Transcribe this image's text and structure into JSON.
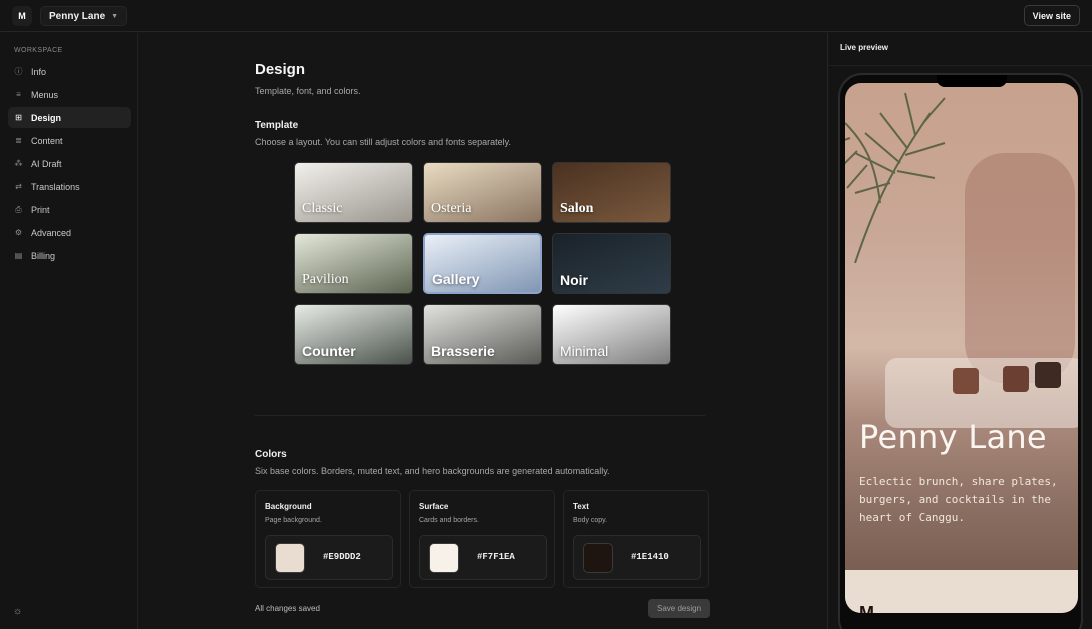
{
  "topbar": {
    "workspace_initial": "M",
    "workspace_name": "Penny Lane",
    "view_site_label": "View site"
  },
  "sidebar": {
    "section_label": "WORKSPACE",
    "items": [
      {
        "label": "Info",
        "icon": "info-icon",
        "glyph": "ⓘ"
      },
      {
        "label": "Menus",
        "icon": "menu-lines-icon",
        "glyph": "≡"
      },
      {
        "label": "Design",
        "icon": "grid-icon",
        "glyph": "⊞"
      },
      {
        "label": "Content",
        "icon": "text-lines-icon",
        "glyph": "≣"
      },
      {
        "label": "AI Draft",
        "icon": "sparkle-icon",
        "glyph": "⁂"
      },
      {
        "label": "Translations",
        "icon": "swap-icon",
        "glyph": "⇄"
      },
      {
        "label": "Print",
        "icon": "printer-icon",
        "glyph": "⎙"
      },
      {
        "label": "Advanced",
        "icon": "gear-icon",
        "glyph": "⚙"
      },
      {
        "label": "Billing",
        "icon": "card-icon",
        "glyph": "▤"
      }
    ],
    "active": "Design"
  },
  "main": {
    "title": "Design",
    "subtitle": "Template, font, and colors.",
    "template": {
      "title": "Template",
      "subtitle": "Choose a layout. You can still adjust colors and fonts separately.",
      "selected": "Gallery",
      "items": [
        {
          "label": "Classic",
          "font": "serif",
          "from": "#f2f0ec",
          "to": "#9a968e"
        },
        {
          "label": "Osteria",
          "font": "serif",
          "from": "#e9dcc3",
          "to": "#8a7460"
        },
        {
          "label": "Salon",
          "font": "serif-bold",
          "from": "#4a3120",
          "to": "#7a5a3e"
        },
        {
          "label": "Pavilion",
          "font": "serif",
          "from": "#e4e8da",
          "to": "#5c6450"
        },
        {
          "label": "Gallery",
          "font": "sans-bold",
          "from": "#eaf0f8",
          "to": "#8096b3"
        },
        {
          "label": "Noir",
          "font": "sans-bold",
          "from": "#1a2229",
          "to": "#2f3d48"
        },
        {
          "label": "Counter",
          "font": "sans-bold",
          "from": "#e8ece6",
          "to": "#4b524c"
        },
        {
          "label": "Brasserie",
          "font": "sans-bold",
          "from": "#e2e2de",
          "to": "#5a5a56"
        },
        {
          "label": "Minimal",
          "font": "sans",
          "from": "#ffffff",
          "to": "#7d7d7d"
        }
      ]
    },
    "colors": {
      "title": "Colors",
      "subtitle": "Six base colors. Borders, muted text, and hero backgrounds are generated automatically.",
      "items": [
        {
          "title": "Background",
          "subtitle": "Page background.",
          "hex": "#E9DDD2"
        },
        {
          "title": "Surface",
          "subtitle": "Cards and borders.",
          "hex": "#F7F1EA"
        },
        {
          "title": "Text",
          "subtitle": "Body copy.",
          "hex": "#1E1410"
        }
      ]
    },
    "status_text": "All changes saved",
    "save_label": "Save design"
  },
  "preview": {
    "title": "Live preview",
    "restaurant_name": "Penny Lane",
    "description": "Eclectic brunch, share plates, burgers, and cocktails in the heart of Canggu.",
    "next_heading": "M"
  }
}
